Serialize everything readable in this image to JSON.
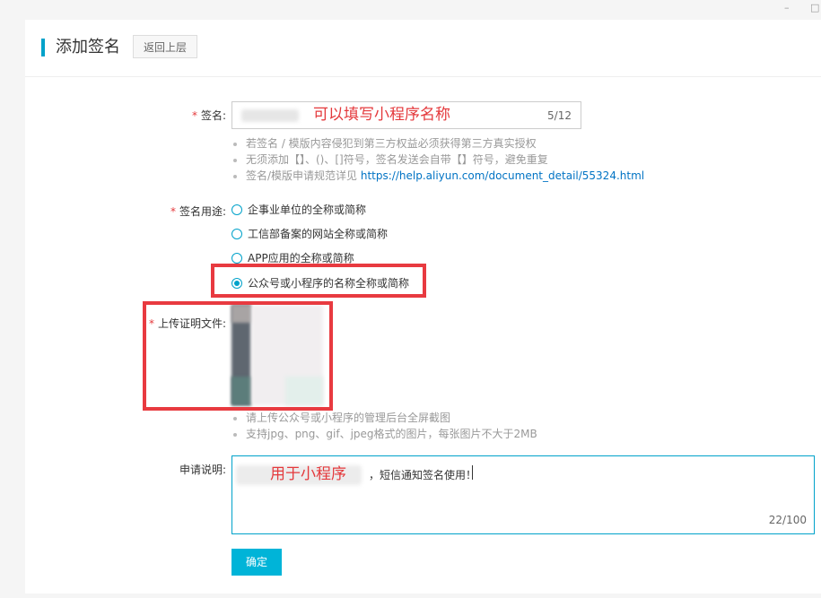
{
  "window": {
    "min_glyph": "–",
    "max_glyph": "□"
  },
  "header": {
    "title": "添加签名",
    "back_label": "返回上层"
  },
  "signature": {
    "label": "签名:",
    "overlay_text": "可以填写小程序名称",
    "counter": "5/12",
    "hints": [
      "若签名 / 模版内容侵犯到第三方权益必须获得第三方真实授权",
      "无须添加【】、()、[]符号，签名发送会自带【】符号，避免重复"
    ],
    "hint_link_prefix": "签名/模版申请规范详见",
    "hint_link": "https://help.aliyun.com/document_detail/55324.html"
  },
  "usage": {
    "label": "签名用途:",
    "options": [
      "企事业单位的全称或简称",
      "工信部备案的网站全称或简称",
      "APP应用的全称或简称",
      "公众号或小程序的名称全称或简称"
    ],
    "selected_index": 3
  },
  "upload": {
    "label": "上传证明文件:",
    "hints": [
      "请上传公众号或小程序的管理后台全屏截图",
      "支持jpg、png、gif、jpeg格式的图片，每张图片不大于2MB"
    ]
  },
  "description": {
    "label": "申请说明:",
    "overlay_text": "用于小程序",
    "text": "，短信通知签名使用！",
    "counter": "22/100"
  },
  "confirm_label": "确定",
  "required_mark": "*",
  "colors": {
    "accent": "#00a2ca",
    "button": "#00b4d8",
    "annotation_red": "#e83a40"
  }
}
